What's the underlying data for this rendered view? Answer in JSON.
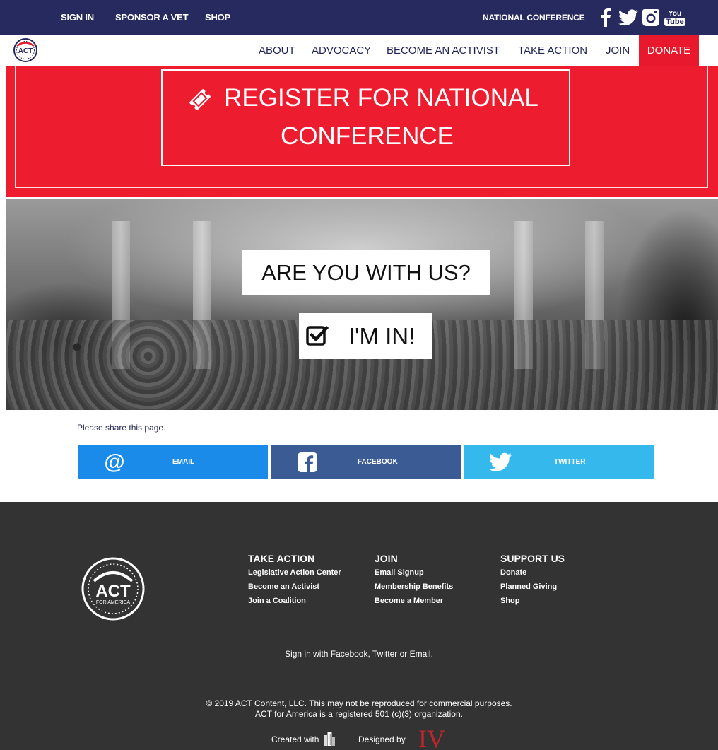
{
  "topbar": {
    "sign_in": "SIGN IN",
    "sponsor": "SPONSOR A VET",
    "shop": "SHOP",
    "conference": "NATIONAL CONFERENCE",
    "social_icons": [
      "facebook-icon",
      "twitter-icon",
      "instagram-icon",
      "youtube-icon"
    ],
    "youtube_top": "You",
    "youtube_bottom": "Tube"
  },
  "nav": {
    "logo_text": "ACT",
    "items": [
      "ABOUT",
      "ADVOCACY",
      "BECOME AN ACTIVIST",
      "TAKE ACTION",
      "JOIN"
    ],
    "donate": "DONATE"
  },
  "register": {
    "line1": "REGISTER FOR NATIONAL",
    "line2": "CONFERENCE"
  },
  "hero": {
    "question": "ARE YOU WITH US?",
    "cta": "I'M IN!"
  },
  "share": {
    "label": "Please share this page.",
    "email": "EMAIL",
    "facebook": "FACEBOOK",
    "twitter": "TWITTER"
  },
  "footer": {
    "logo_top": "ACT",
    "logo_bottom": "FOR AMERICA",
    "columns": [
      {
        "title": "TAKE ACTION",
        "links": [
          "Legislative Action Center",
          "Become an Activist",
          "Join a Coalition"
        ]
      },
      {
        "title": "JOIN",
        "links": [
          "Email Signup",
          "Membership Benefits",
          "Become a Member"
        ]
      },
      {
        "title": "SUPPORT US",
        "links": [
          "Donate",
          "Planned Giving",
          "Shop"
        ]
      }
    ],
    "signin_text": "Sign in with Facebook, Twitter or Email.",
    "copyright": "© 2019 ACT Content, LLC. This may not be reproduced for commercial purposes.",
    "org_note": "ACT for America is a registered 501 (c)(3) organization.",
    "created_with": "Created with",
    "designed_by": "Designed by",
    "designer_mark": "IV"
  },
  "colors": {
    "navy": "#262a5e",
    "red": "#ed1c2e",
    "email_blue": "#1a8be8",
    "facebook_blue": "#3b5b94",
    "twitter_blue": "#35b8ec",
    "footer_bg": "#333333"
  }
}
